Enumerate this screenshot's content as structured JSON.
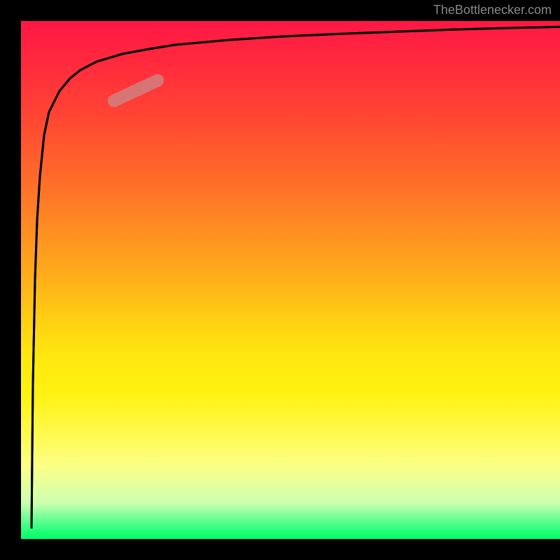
{
  "watermark": "TheBottlenecker.com",
  "chart_data": {
    "type": "line",
    "title": "",
    "xlabel": "",
    "ylabel": "",
    "xlim": [
      0,
      100
    ],
    "ylim": [
      0,
      100
    ],
    "series": [
      {
        "name": "curve",
        "x": [
          2,
          2.5,
          3,
          3.5,
          4,
          5,
          6,
          8,
          10,
          12,
          15,
          20,
          25,
          30,
          40,
          50,
          60,
          70,
          80,
          90,
          100
        ],
        "values": [
          2,
          30,
          50,
          62,
          70,
          78,
          82,
          86,
          88.5,
          90,
          91.5,
          93,
          94,
          94.8,
          95.8,
          96.5,
          97,
          97.4,
          97.8,
          98.1,
          98.4
        ]
      }
    ],
    "highlight": {
      "x_range": [
        18,
        25
      ],
      "y_range": [
        84,
        88
      ]
    },
    "gradient_colors": {
      "top": "#ff1744",
      "middle": "#ffe810",
      "bottom": "#00ff66"
    }
  }
}
